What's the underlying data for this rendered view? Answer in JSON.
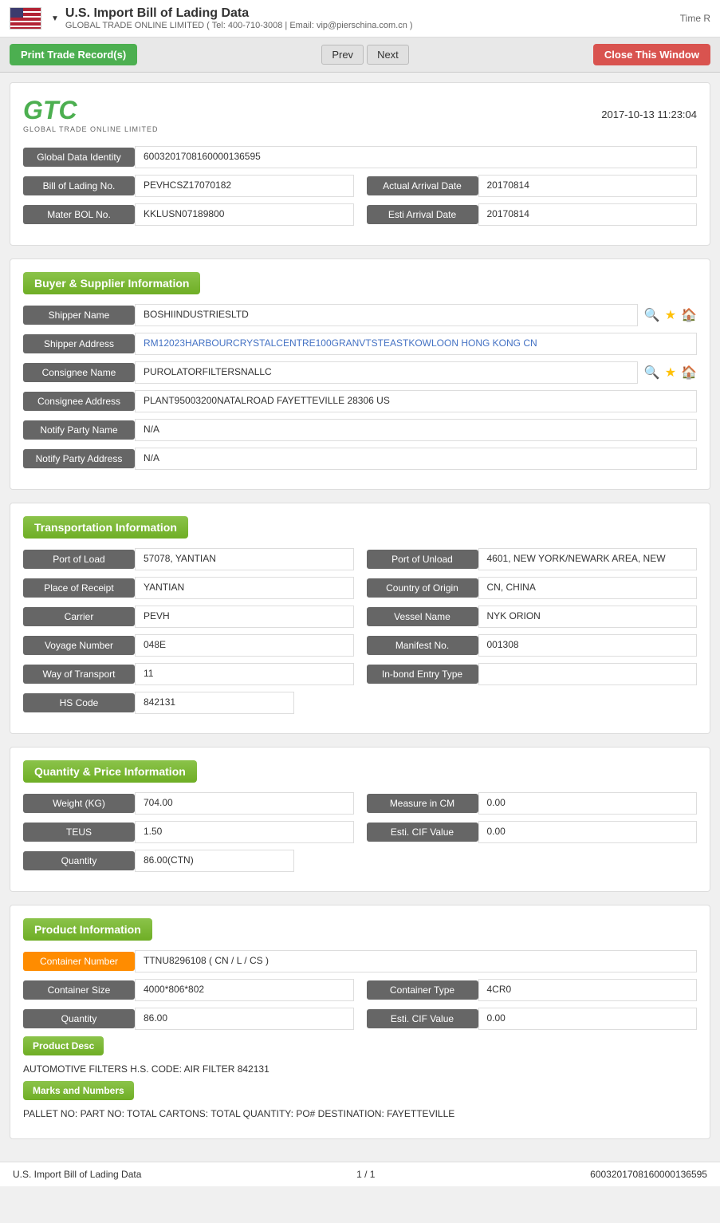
{
  "app": {
    "title": "U.S. Import Bill of Lading Data",
    "dropdown_arrow": "▼",
    "subtitle": "GLOBAL TRADE ONLINE LIMITED ( Tel: 400-710-3008 | Email: vip@pierschina.com.cn )",
    "header_right": "Time R"
  },
  "toolbar": {
    "print_label": "Print Trade Record(s)",
    "prev_label": "Prev",
    "next_label": "Next",
    "close_label": "Close This Window"
  },
  "document": {
    "timestamp": "2017-10-13 11:23:04",
    "logo_main": "GTC",
    "logo_sub": "GLOBAL TRADE ONLINE LIMITED",
    "global_data_identity_label": "Global Data Identity",
    "global_data_identity_value": "6003201708160000136595",
    "bill_of_lading_label": "Bill of Lading No.",
    "bill_of_lading_value": "PEVHCSZ17070182",
    "actual_arrival_date_label": "Actual Arrival Date",
    "actual_arrival_date_value": "20170814",
    "mater_bol_label": "Mater BOL No.",
    "mater_bol_value": "KKLUSN07189800",
    "esti_arrival_date_label": "Esti Arrival Date",
    "esti_arrival_date_value": "20170814"
  },
  "buyer_supplier": {
    "section_title": "Buyer & Supplier Information",
    "shipper_name_label": "Shipper Name",
    "shipper_name_value": "BOSHIINDUSTRIESLTD",
    "shipper_address_label": "Shipper Address",
    "shipper_address_value": "RM12023HARBOURCRYSTALCENTRE100GRANVTSTEASTKOWLOON HONG KONG CN",
    "consignee_name_label": "Consignee Name",
    "consignee_name_value": "PUROLATORFILTERSNALLC",
    "consignee_address_label": "Consignee Address",
    "consignee_address_value": "PLANT95003200NATALROAD FAYETTEVILLE 28306 US",
    "notify_party_name_label": "Notify Party Name",
    "notify_party_name_value": "N/A",
    "notify_party_address_label": "Notify Party Address",
    "notify_party_address_value": "N/A"
  },
  "transportation": {
    "section_title": "Transportation Information",
    "port_of_load_label": "Port of Load",
    "port_of_load_value": "57078, YANTIAN",
    "port_of_unload_label": "Port of Unload",
    "port_of_unload_value": "4601, NEW YORK/NEWARK AREA, NEW",
    "place_of_receipt_label": "Place of Receipt",
    "place_of_receipt_value": "YANTIAN",
    "country_of_origin_label": "Country of Origin",
    "country_of_origin_value": "CN, CHINA",
    "carrier_label": "Carrier",
    "carrier_value": "PEVH",
    "vessel_name_label": "Vessel Name",
    "vessel_name_value": "NYK ORION",
    "voyage_number_label": "Voyage Number",
    "voyage_number_value": "048E",
    "manifest_no_label": "Manifest No.",
    "manifest_no_value": "001308",
    "way_of_transport_label": "Way of Transport",
    "way_of_transport_value": "11",
    "inbond_entry_type_label": "In-bond Entry Type",
    "inbond_entry_type_value": "",
    "hs_code_label": "HS Code",
    "hs_code_value": "842131"
  },
  "quantity_price": {
    "section_title": "Quantity & Price Information",
    "weight_label": "Weight (KG)",
    "weight_value": "704.00",
    "measure_label": "Measure in CM",
    "measure_value": "0.00",
    "teus_label": "TEUS",
    "teus_value": "1.50",
    "esti_cif_label": "Esti. CIF Value",
    "esti_cif_value": "0.00",
    "quantity_label": "Quantity",
    "quantity_value": "86.00(CTN)"
  },
  "product_information": {
    "section_title": "Product Information",
    "container_number_label": "Container Number",
    "container_number_value": "TTNU8296108 ( CN / L / CS )",
    "container_size_label": "Container Size",
    "container_size_value": "4000*806*802",
    "container_type_label": "Container Type",
    "container_type_value": "4CR0",
    "quantity_label": "Quantity",
    "quantity_value": "86.00",
    "esti_cif_label": "Esti. CIF Value",
    "esti_cif_value": "0.00",
    "product_desc_label": "Product Desc",
    "product_desc_text": "AUTOMOTIVE FILTERS H.S. CODE: AIR FILTER 842131",
    "marks_numbers_label": "Marks and Numbers",
    "marks_numbers_text": "PALLET NO: PART NO: TOTAL CARTONS: TOTAL QUANTITY: PO# DESTINATION: FAYETTEVILLE"
  },
  "footer": {
    "doc_type": "U.S. Import Bill of Lading Data",
    "page_info": "1 / 1",
    "doc_id": "6003201708160000136595"
  }
}
